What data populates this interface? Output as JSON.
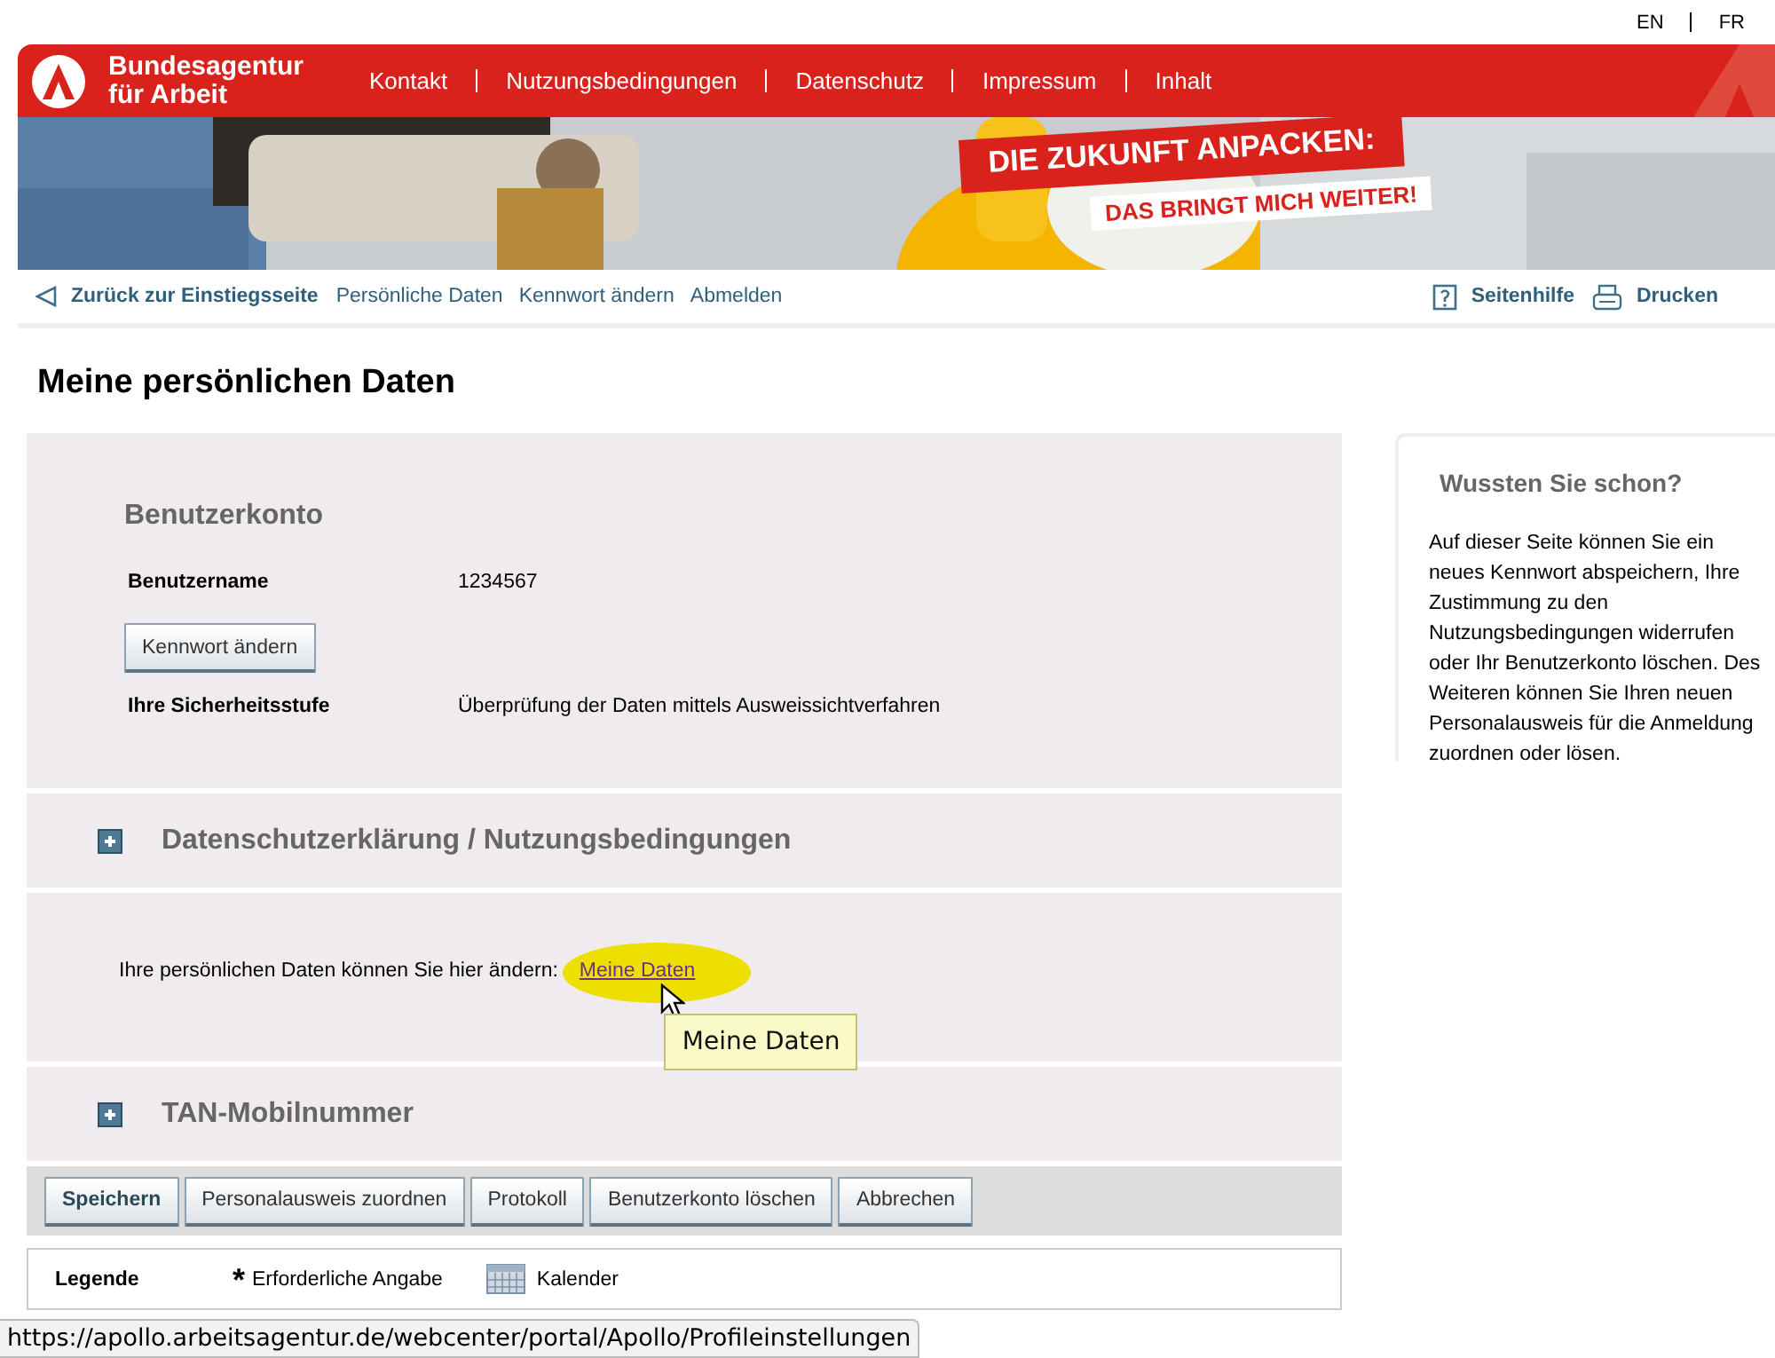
{
  "language_links": [
    "EN",
    "FR"
  ],
  "header": {
    "brand": [
      "Bundesagentur",
      "für Arbeit"
    ],
    "nav": [
      "Kontakt",
      "Nutzungsbedingungen",
      "Datenschutz",
      "Impressum",
      "Inhalt"
    ]
  },
  "banner": {
    "kind": "picture",
    "headline": "DIE ZUKUNFT ANPACKEN:",
    "subline": "DAS BRINGT MICH WEITER!"
  },
  "toolbar": {
    "back": "Zurück zur Einstiegsseite",
    "links": [
      "Persönliche Daten",
      "Kennwort ändern",
      "Abmelden"
    ],
    "help": "Seitenhilfe",
    "print": "Drucken"
  },
  "title": "Meine persönlichen Daten",
  "account": {
    "heading": "Benutzerkonto",
    "items": [
      {
        "kind": "field",
        "label": "Benutzername",
        "value": "1234567"
      },
      {
        "kind": "button",
        "label": "Kennwort ändern"
      },
      {
        "kind": "field",
        "label": "Ihre Sicherheitsstufe",
        "value": "Überprüfung der Daten mittels Ausweissichtverfahren"
      }
    ]
  },
  "sections": [
    {
      "kind": "collapsible",
      "title": "Datenschutzerklärung / Nutzungsbedingungen",
      "expanded": false
    },
    {
      "kind": "text",
      "text": "Ihre persönlichen Daten können Sie hier ändern:",
      "link": "Meine Daten",
      "tooltip": "Meine Daten"
    },
    {
      "kind": "collapsible",
      "title": "TAN-Mobilnummer",
      "expanded": false
    }
  ],
  "buttons": [
    {
      "label": "Speichern",
      "primary": true
    },
    {
      "label": "Personalausweis zuordnen",
      "primary": false
    },
    {
      "label": "Protokoll",
      "primary": false
    },
    {
      "label": "Benutzerkonto löschen",
      "primary": false
    },
    {
      "label": "Abbrechen",
      "primary": false
    }
  ],
  "legend": {
    "title": "Legende",
    "items": [
      {
        "kind": "required",
        "symbol": "*",
        "label": "Erforderliche Angabe"
      },
      {
        "kind": "calendar",
        "label": "Kalender"
      }
    ]
  },
  "sidebar": {
    "title": "Wussten Sie schon?",
    "text": "Auf dieser Seite können Sie ein neues Kennwort abspeichern, Ihre Zustimmung zu den Nutzungsbedingungen widerrufen oder Ihr Benutzerkonto löschen. Des Weiteren können Sie Ihren neuen Personalausweis für die Anmeldung zuordnen oder lösen."
  },
  "status_bar": {
    "url": "https://apollo.arbeitsagentur.de/webcenter/portal/Apollo/Profileinstellungen"
  }
}
